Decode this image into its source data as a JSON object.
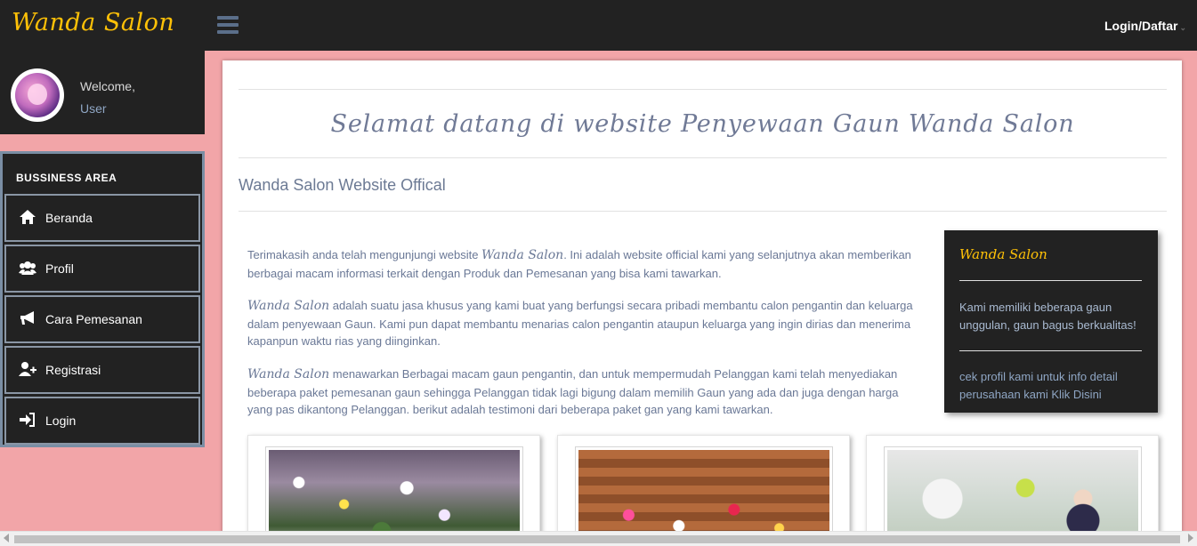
{
  "navbar": {
    "brand": "Wanda Salon",
    "menu_icon": "hamburger-icon",
    "login_label": "Login/Daftar",
    "caret_icon": "chevron-down-icon"
  },
  "profile": {
    "welcome": "Welcome,",
    "user": "User"
  },
  "sidebar": {
    "title": "BUSSINESS AREA",
    "items": [
      {
        "label": "Beranda",
        "icon": "home-icon"
      },
      {
        "label": "Profil",
        "icon": "users-icon"
      },
      {
        "label": "Cara Pemesanan",
        "icon": "bullhorn-icon"
      },
      {
        "label": "Registrasi",
        "icon": "user-plus-icon"
      },
      {
        "label": "Login",
        "icon": "sign-in-icon"
      }
    ]
  },
  "main": {
    "title": "Selamat datang di website Penyewaan Gaun Wanda Salon",
    "subtitle": "Wanda Salon Website Offical",
    "p1": {
      "pre": "Terimakasih anda telah mengunjungi website ",
      "brand": "Wanda Salon",
      "post": ". Ini adalah website official kami yang selanjutnya akan memberikan berbagai macam informasi terkait dengan Produk dan Pemesanan yang bisa kami tawarkan."
    },
    "p2": {
      "brand": "Wanda Salon",
      "post": " adalah suatu jasa khusus yang kami buat yang berfungsi secara pribadi membantu calon pengantin dan keluarga dalam penyewaan Gaun. Kami pun dapat membantu menarias calon pengantin ataupun keluarga yang ingin dirias dan menerima kapanpun waktu rias yang diinginkan."
    },
    "p3": {
      "brand": "Wanda Salon",
      "post": " menawarkan Berbagai macam gaun pengantin, dan untuk mempermudah Pelanggan kami telah menyediakan beberapa paket pemesanan gaun sehingga Pelanggan tidak lagi bigung dalam memilih Gaun yang ada dan juga dengan harga yang pas dikantong Pelanggan. berikut adalah testimoni dari beberapa paket gan yang kami tawarkan."
    }
  },
  "infobox": {
    "title": "Wanda Salon",
    "text": "Kami memiliki beberapa gaun unggulan, gaun bagus berkualitas!",
    "link_text": "cek profil kami untuk info detail perusahaan kami Klik Disini"
  },
  "colors": {
    "navbar": "#222222",
    "brand": "#ffc107",
    "background": "#f2a5a8"
  }
}
